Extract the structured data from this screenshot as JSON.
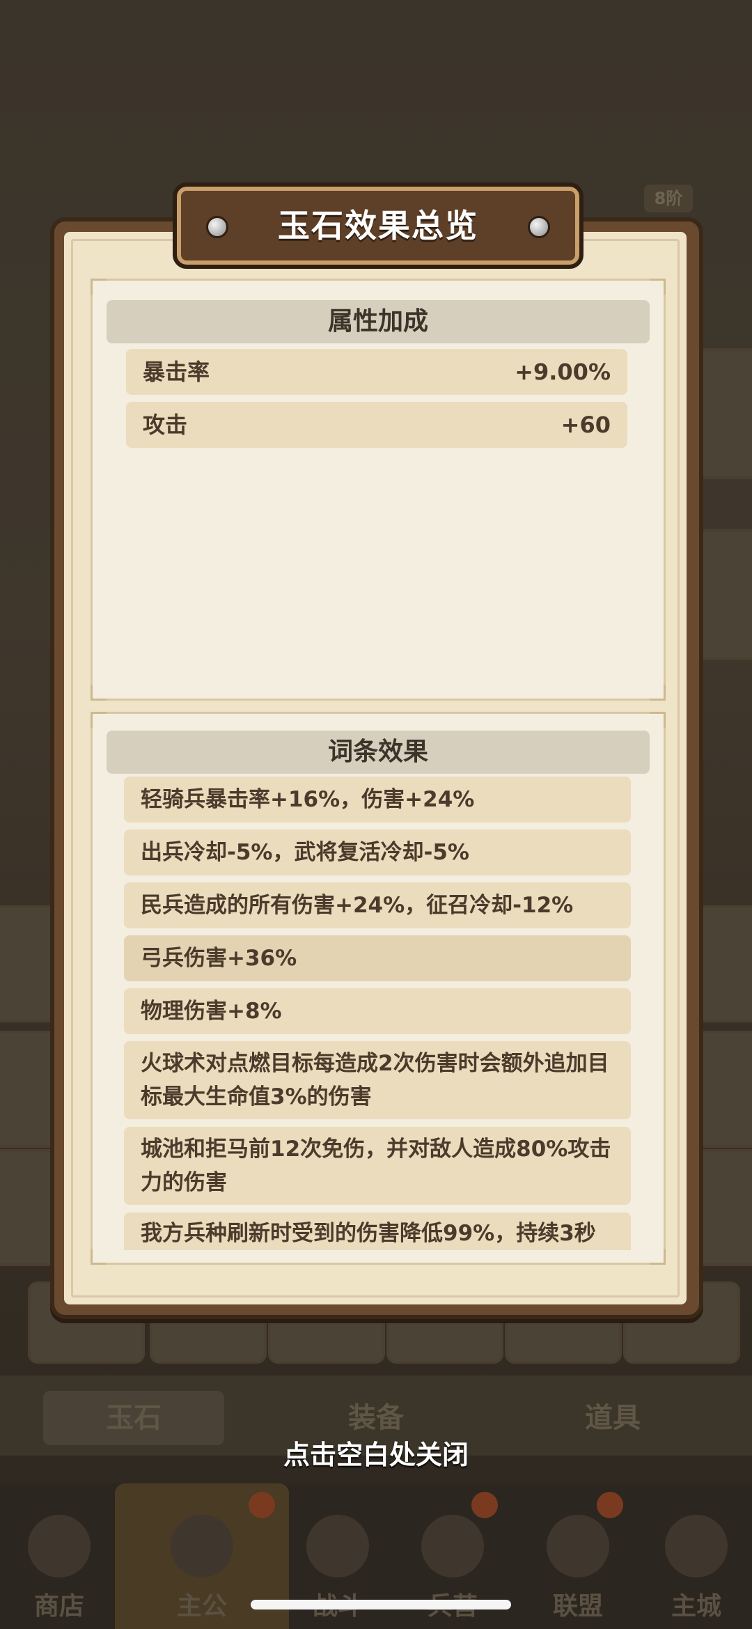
{
  "dialog": {
    "title": "玉石效果总览",
    "attributes_header": "属性加成",
    "attributes": [
      {
        "label": "暴击率",
        "value": "+9.00%"
      },
      {
        "label": "攻击",
        "value": "+60"
      }
    ],
    "effects_header": "词条效果",
    "effects": [
      "轻骑兵暴击率+16%，伤害+24%",
      "出兵冷却-5%，武将复活冷却-5%",
      "民兵造成的所有伤害+24%，征召冷却-12%",
      "弓兵伤害+36%",
      "物理伤害+8%",
      "火球术对点燃目标每造成2次伤害时会额外追加目标最大生命值3%的伤害",
      "城池和拒马前12次免伤，并对敌人造成80%攻击力的伤害",
      "我方兵种刷新时受到的伤害降低99%，持续3秒"
    ],
    "close_hint": "点击空白处关闭"
  },
  "background": {
    "tier_badge": "8阶",
    "tabs": [
      "玉石",
      "装备",
      "道具"
    ],
    "nav": [
      "商店",
      "主公",
      "战斗",
      "兵营",
      "联盟",
      "主城"
    ]
  }
}
